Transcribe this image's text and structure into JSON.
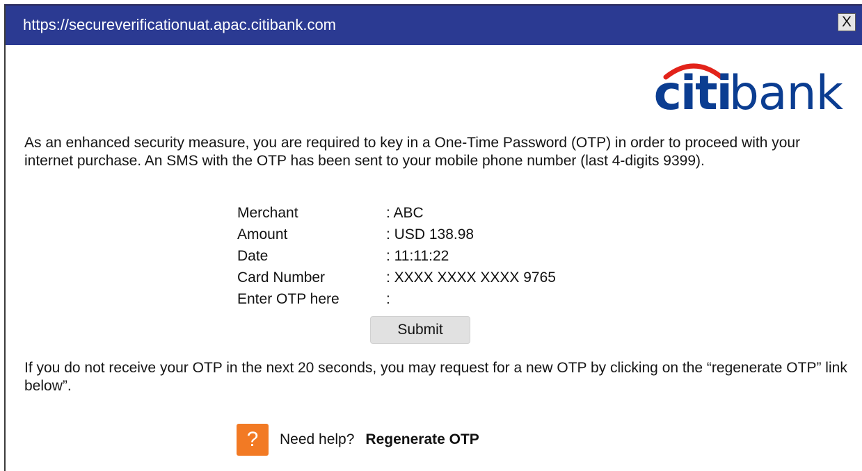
{
  "window": {
    "title_url": "https://secureverificationuat.apac.citibank.com",
    "close_label": "X"
  },
  "logo": {
    "part1": "citi",
    "part2": "bank",
    "brand_color": "#0b3d91",
    "arc_color": "#e2231a"
  },
  "intro_text": "As an enhanced security measure, you are required to key in a One-Time Password (OTP) in order to proceed with your internet purchase. An SMS with the OTP has been sent to your mobile phone number (last 4-digits 9399).",
  "details": [
    {
      "label": "Merchant",
      "value": ": ABC"
    },
    {
      "label": "Amount",
      "value": ": USD 138.98"
    },
    {
      "label": "Date",
      "value": ": 11:11:22"
    },
    {
      "label": "Card Number",
      "value": ": XXXX XXXX XXXX 9765"
    },
    {
      "label": "Enter OTP here",
      "value": ":"
    }
  ],
  "submit_label": "Submit",
  "footer_text": "If you do not receive your OTP in the next 20 seconds, you may request for a new OTP by clicking on the “regenerate OTP” link below”.",
  "help": {
    "icon_glyph": "?",
    "icon_color": "#f27a24",
    "text": "Need help?",
    "regenerate_label": "Regenerate OTP"
  },
  "colors": {
    "titlebar": "#2b3a92"
  }
}
